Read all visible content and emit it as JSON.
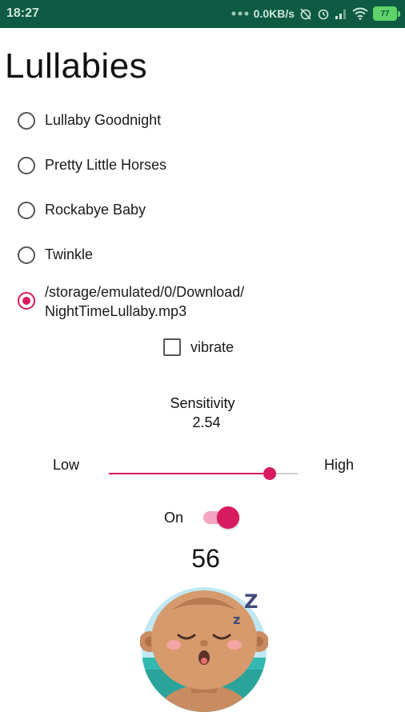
{
  "status_bar": {
    "time": "18:27",
    "network_speed": "0.0KB/s",
    "battery_level": "77",
    "icons": [
      "dots-icon",
      "alarm-off-icon",
      "alarm-icon",
      "signal-icon",
      "wifi-icon",
      "battery-icon"
    ]
  },
  "title": "Lullabies",
  "lullabies": [
    {
      "label": "Lullaby Goodnight",
      "checked": false
    },
    {
      "label": "Pretty Little Horses",
      "checked": false
    },
    {
      "label": "Rockabye Baby",
      "checked": false
    },
    {
      "label": "Twinkle",
      "checked": false
    },
    {
      "label": "/storage/emulated/0/Download/\nNightTimeLullaby.mp3",
      "checked": true
    }
  ],
  "vibrate": {
    "label": "vibrate",
    "checked": false
  },
  "sensitivity": {
    "label": "Sensitivity",
    "value": "2.54",
    "low_label": "Low",
    "high_label": "High",
    "slider_fraction": 0.85
  },
  "switch": {
    "label": "On",
    "on": true
  },
  "counter": "56",
  "colors": {
    "accent": "#d81b60",
    "status_bar": "#0e5a43"
  }
}
